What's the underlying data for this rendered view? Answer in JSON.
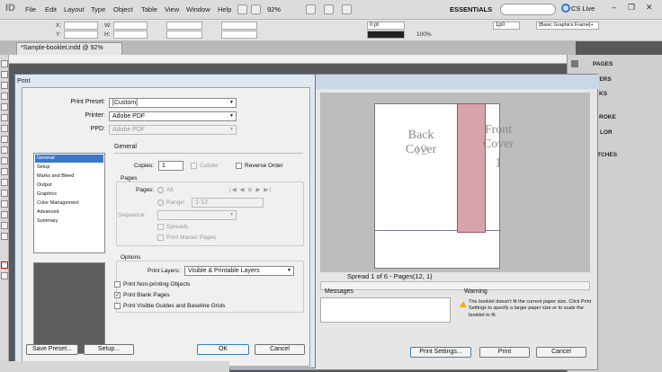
{
  "menubar": {
    "app_icon": "ID",
    "items": [
      "File",
      "Edit",
      "Layout",
      "Type",
      "Object",
      "Table",
      "View",
      "Window",
      "Help"
    ],
    "zoom": "92%",
    "workspace": "ESSENTIALS",
    "cs_live": "CS Live"
  },
  "controlbar": {
    "labels": [
      "X:",
      "Y:",
      "W:",
      "H:"
    ],
    "stroke_weight": "0 pt",
    "percent": "100%",
    "frame_style": "[Basic Graphics Frame]+",
    "gutter": "1p0"
  },
  "document": {
    "tab_title": "*Sample-booklet.indd @ 92%"
  },
  "panels": {
    "items": [
      "PAGES",
      "YERS",
      "KS",
      "ROKE",
      "LOR",
      "TCHES"
    ]
  },
  "print_dialog": {
    "title": "Print",
    "print_preset_label": "Print Preset:",
    "print_preset_value": "[Custom]",
    "printer_label": "Printer:",
    "printer_value": "Adobe PDF",
    "ppd_label": "PPD:",
    "ppd_value": "Adobe PDF",
    "categories": [
      "General",
      "Setup",
      "Marks and Bleed",
      "Output",
      "Graphics",
      "Color Management",
      "Advanced",
      "Summary"
    ],
    "section_title": "General",
    "copies_label": "Copies:",
    "copies_value": "1",
    "collate_label": "Collate",
    "reverse_order_label": "Reverse Order",
    "pages_heading": "Pages",
    "pages_label": "Pages:",
    "all_label": "All",
    "range_label": "Range:",
    "range_value": "1-12",
    "sequence_label": "Sequence:",
    "spreads_label": "Spreads",
    "print_master_pages_label": "Print Master Pages",
    "options_heading": "Options",
    "print_layers_label": "Print Layers:",
    "print_layers_value": "Visible & Printable Layers",
    "print_nonprinting_label": "Print Non-printing Objects",
    "print_blank_pages_label": "Print Blank Pages",
    "print_guides_label": "Print Visible Guides and Baseline Grids",
    "print_nonprinting_checked": false,
    "print_blank_pages_checked": true,
    "print_guides_checked": false,
    "save_preset_button": "Save Preset...",
    "setup_button": "Setup...",
    "ok_button": "OK",
    "cancel_button": "Cancel"
  },
  "print_preview": {
    "back_cover": "Back Cover",
    "back_page_number": "12",
    "front_cover": "Front Cover",
    "front_page_number": "1",
    "spread_info": "Spread 1 of 6 - Pages(12, 1)",
    "messages_label": "Messages",
    "warning_label": "Warning",
    "warning_text": "The booklet doesn't fit the current paper size. Click Print Settings to specify a larger paper size or to scale the booklet to fit.",
    "print_settings_button": "Print Settings...",
    "print_button": "Print",
    "cancel_button": "Cancel"
  },
  "colors": {
    "accent": "#3b79c8",
    "bleed": "#d8a3aa"
  }
}
